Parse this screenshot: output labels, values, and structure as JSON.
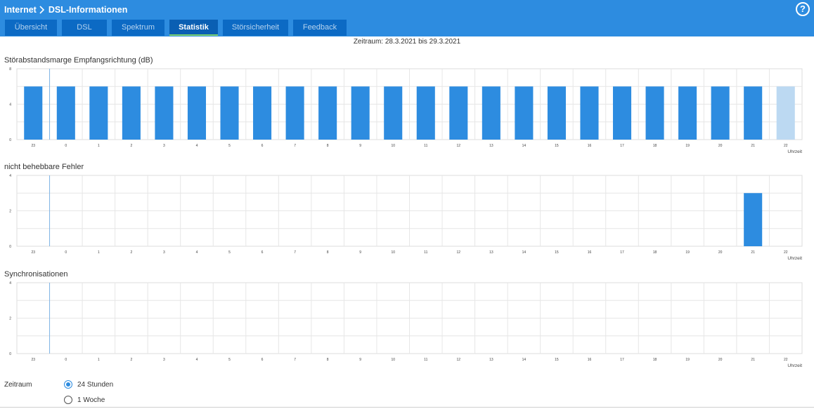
{
  "breadcrumb": {
    "parent": "Internet",
    "current": "DSL-Informationen"
  },
  "help_label": "?",
  "tabs": [
    {
      "label": "Übersicht",
      "active": false
    },
    {
      "label": "DSL",
      "active": false
    },
    {
      "label": "Spektrum",
      "active": false
    },
    {
      "label": "Statistik",
      "active": true
    },
    {
      "label": "Störsicherheit",
      "active": false
    },
    {
      "label": "Feedback",
      "active": false
    }
  ],
  "period_text": "Zeitraum: 28.3.2021 bis 29.3.2021",
  "colors": {
    "header": "#2d8ce0",
    "tab": "#0c6ac4",
    "bar": "#2d8ce0",
    "bar_light": "#bcd9f2",
    "grid": "#e6e6e6"
  },
  "chart_data": [
    {
      "type": "bar",
      "title": "Störabstandsmarge Empfangsrichtung (dB)",
      "xlabel": "Uhrzeit",
      "categories": [
        "23",
        "0",
        "1",
        "2",
        "3",
        "4",
        "5",
        "6",
        "7",
        "8",
        "9",
        "10",
        "11",
        "12",
        "13",
        "14",
        "15",
        "16",
        "17",
        "18",
        "19",
        "20",
        "21",
        "22"
      ],
      "values": [
        6,
        6,
        6,
        6,
        6,
        6,
        6,
        6,
        6,
        6,
        6,
        6,
        6,
        6,
        6,
        6,
        6,
        6,
        6,
        6,
        6,
        6,
        6,
        6
      ],
      "partial_last": true,
      "ylim": [
        0,
        8
      ],
      "yticks": [
        "0",
        "4",
        "8"
      ]
    },
    {
      "type": "bar",
      "title": "nicht behebbare Fehler",
      "xlabel": "Uhrzeit",
      "categories": [
        "23",
        "0",
        "1",
        "2",
        "3",
        "4",
        "5",
        "6",
        "7",
        "8",
        "9",
        "10",
        "11",
        "12",
        "13",
        "14",
        "15",
        "16",
        "17",
        "18",
        "19",
        "20",
        "21",
        "22"
      ],
      "values": [
        0,
        0,
        0,
        0,
        0,
        0,
        0,
        0,
        0,
        0,
        0,
        0,
        0,
        0,
        0,
        0,
        0,
        0,
        0,
        0,
        0,
        0,
        3,
        0
      ],
      "partial_last": false,
      "ylim": [
        0,
        4
      ],
      "yticks": [
        "0",
        "2",
        "4"
      ]
    },
    {
      "type": "bar",
      "title": "Synchronisationen",
      "xlabel": "Uhrzeit",
      "categories": [
        "23",
        "0",
        "1",
        "2",
        "3",
        "4",
        "5",
        "6",
        "7",
        "8",
        "9",
        "10",
        "11",
        "12",
        "13",
        "14",
        "15",
        "16",
        "17",
        "18",
        "19",
        "20",
        "21",
        "22"
      ],
      "values": [
        0,
        0,
        0,
        0,
        0,
        0,
        0,
        0,
        0,
        0,
        0,
        0,
        0,
        0,
        0,
        0,
        0,
        0,
        0,
        0,
        0,
        0,
        0,
        0
      ],
      "partial_last": false,
      "ylim": [
        0,
        4
      ],
      "yticks": [
        "0",
        "2",
        "4"
      ]
    }
  ],
  "zeitraum": {
    "label": "Zeitraum",
    "options": [
      {
        "label": "24 Stunden",
        "checked": true
      },
      {
        "label": "1 Woche",
        "checked": false
      }
    ]
  }
}
